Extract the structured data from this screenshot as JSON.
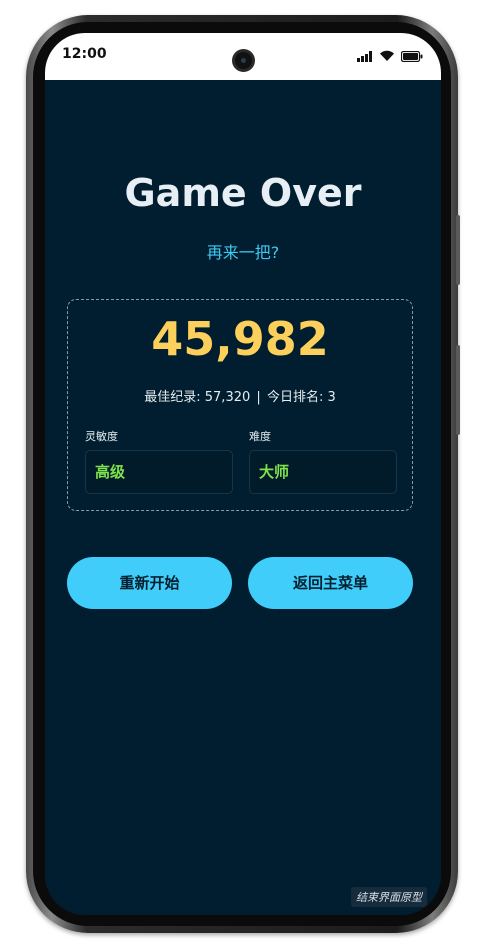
{
  "status_bar": {
    "time": "12:00",
    "icons": [
      "signal-icon",
      "wifi-icon",
      "battery-icon"
    ]
  },
  "game_over": {
    "title": "Game Over",
    "subtitle": "再来一把?"
  },
  "score_card": {
    "score": "45,982",
    "best_label": "最佳纪录:",
    "best_value": "57,320",
    "separator": "|",
    "rank_label": "今日排名:",
    "rank_value": "3",
    "sensitivity_label": "灵敏度",
    "sensitivity_value": "高级",
    "difficulty_label": "难度",
    "difficulty_value": "大师"
  },
  "actions": {
    "restart_label": "重新开始",
    "main_menu_label": "返回主菜单"
  },
  "watermark": "结束界面原型",
  "colors": {
    "background": "#001e2f",
    "title": "#e7eef4",
    "subtitle": "#3fc8f2",
    "score": "#fcd05a",
    "field_value": "#7ee24a",
    "button": "#40cdfa"
  }
}
